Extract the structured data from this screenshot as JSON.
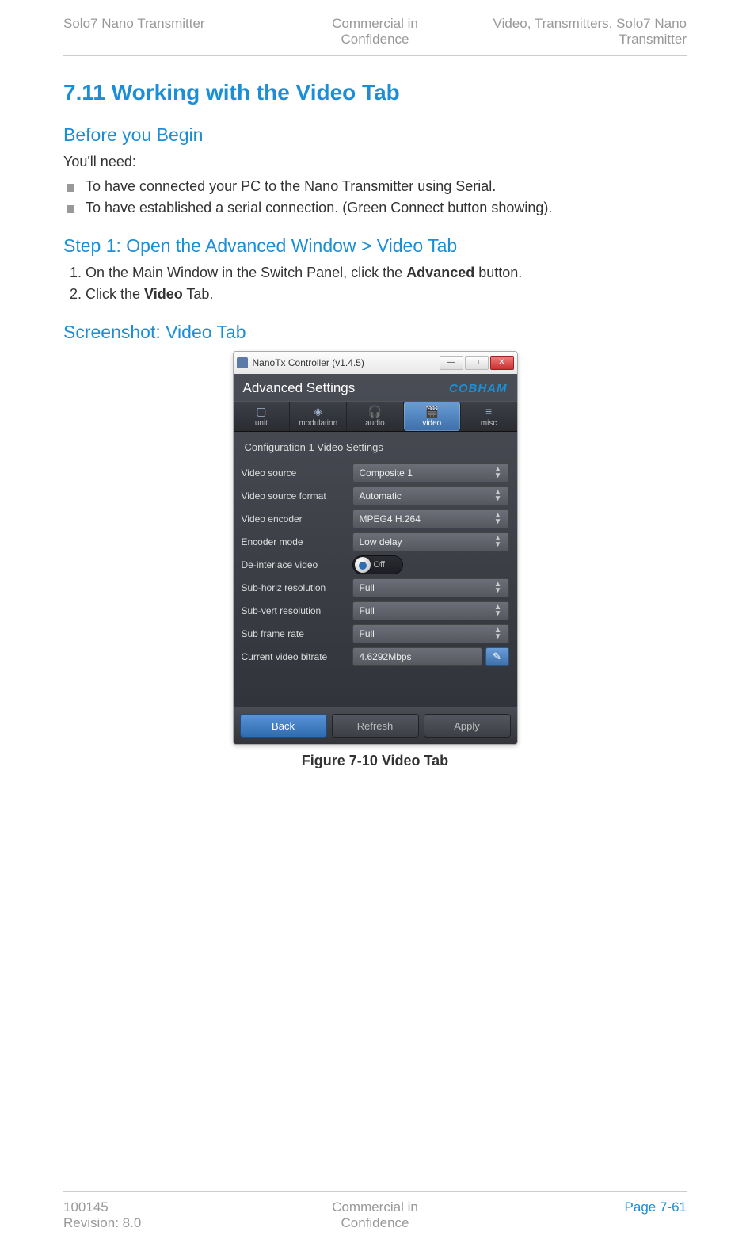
{
  "header": {
    "left": "Solo7 Nano Transmitter",
    "mid_line1": "Commercial in",
    "mid_line2": "Confidence",
    "right_line1": "Video, Transmitters, Solo7 Nano",
    "right_line2": "Transmitter"
  },
  "section": {
    "number": "7.11",
    "title": "Working with the Video Tab"
  },
  "before": {
    "heading": "Before you Begin",
    "lead": "You'll need:",
    "items": [
      "To have connected your PC to the Nano Transmitter using Serial.",
      "To have established a serial connection. (Green Connect button showing)."
    ]
  },
  "step1": {
    "heading": "Step 1: Open the Advanced Window > Video Tab",
    "items": {
      "li1_pre": "On the Main Window in the Switch Panel, click the ",
      "li1_bold": "Advanced",
      "li1_post": " button.",
      "li2_pre": "Click the ",
      "li2_bold": "Video",
      "li2_post": " Tab."
    }
  },
  "screenshot_heading": "Screenshot: Video Tab",
  "app": {
    "title": "NanoTx Controller (v1.4.5)",
    "header": "Advanced Settings",
    "brand": "COBHAM",
    "tabs": {
      "unit": "unit",
      "modulation": "modulation",
      "audio": "audio",
      "video": "video",
      "misc": "misc"
    },
    "panel_title": "Configuration 1 Video Settings",
    "rows": {
      "video_source": {
        "label": "Video source",
        "value": "Composite 1"
      },
      "video_source_format": {
        "label": "Video source format",
        "value": "Automatic"
      },
      "video_encoder": {
        "label": "Video encoder",
        "value": "MPEG4 H.264"
      },
      "encoder_mode": {
        "label": "Encoder mode",
        "value": "Low delay"
      },
      "deinterlace": {
        "label": "De-interlace video",
        "value": "Off"
      },
      "sub_horiz": {
        "label": "Sub-horiz resolution",
        "value": "Full"
      },
      "sub_vert": {
        "label": "Sub-vert resolution",
        "value": "Full"
      },
      "sub_frame": {
        "label": "Sub frame rate",
        "value": "Full"
      },
      "bitrate": {
        "label": "Current video bitrate",
        "value": "4.6292Mbps"
      }
    },
    "buttons": {
      "back": "Back",
      "refresh": "Refresh",
      "apply": "Apply"
    },
    "win": {
      "min": "—",
      "max": "□",
      "close": "✕"
    }
  },
  "caption": "Figure 7-10 Video Tab",
  "footer": {
    "left_line1": "100145",
    "left_line2": "Revision: 8.0",
    "mid_line1": "Commercial in",
    "mid_line2": "Confidence",
    "right": "Page 7-61"
  }
}
